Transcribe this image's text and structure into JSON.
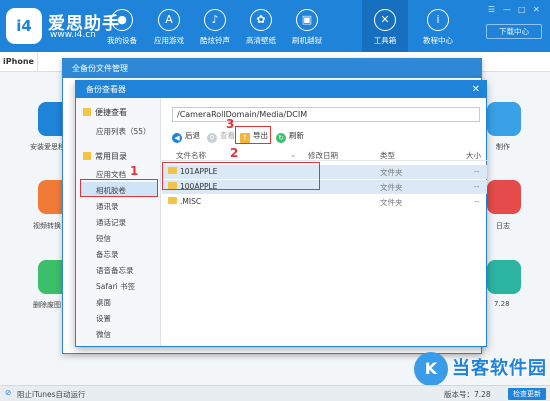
{
  "app": {
    "logo_text": "i4",
    "brand": "爱思助手",
    "url": "www.i4.cn",
    "download_center": "下载中心",
    "win_controls": [
      "☰",
      "—",
      "□",
      "✕"
    ]
  },
  "nav": [
    {
      "label": "我的设备",
      "icon": "apple-icon",
      "glyph": ""
    },
    {
      "label": "应用游戏",
      "icon": "appstore-icon",
      "glyph": "A"
    },
    {
      "label": "酷炫铃声",
      "icon": "bell-icon",
      "glyph": "♪"
    },
    {
      "label": "高清壁纸",
      "icon": "flower-icon",
      "glyph": "✿"
    },
    {
      "label": "刷机越狱",
      "icon": "box-icon",
      "glyph": "▣"
    },
    {
      "label": "工具箱",
      "icon": "tools-icon",
      "glyph": "✕"
    },
    {
      "label": "教程中心",
      "icon": "info-icon",
      "glyph": "i"
    }
  ],
  "device_tab": "iPhone",
  "background_labels": [
    "安装爱思移",
    "视频转换",
    "删除废图",
    "制作",
    "日志",
    "7.28"
  ],
  "dialog_outer": {
    "title": "全备份文件管理"
  },
  "dialog": {
    "title": "备份查看器",
    "close": "✕",
    "sidebar": {
      "group1": "便捷查看",
      "group1_items": [
        "应用列表（55）"
      ],
      "group2": "常用目录",
      "group2_items": [
        "应用文档",
        "相机胶卷",
        "通讯录",
        "通话记录",
        "短信",
        "备忘录",
        "语音备忘录",
        "Safari 书签",
        "桌面",
        "设置",
        "微信"
      ]
    },
    "path": "/CameraRollDomain/Media/DCIM",
    "toolbar": {
      "back": "后退",
      "find": "查看",
      "export": "导出",
      "refresh": "刷新"
    },
    "columns": {
      "name": "文件名称",
      "date": "修改日期",
      "type": "类型",
      "size": "大小"
    },
    "rows": [
      {
        "name": "101APPLE",
        "type": "文件夹",
        "size": "--"
      },
      {
        "name": "100APPLE",
        "type": "文件夹",
        "size": "--"
      },
      {
        "name": ".MISC",
        "type": "文件夹",
        "size": "--"
      }
    ]
  },
  "annotations": [
    "1",
    "2",
    "3"
  ],
  "status": {
    "itunes": "阻止iTunes自动运行",
    "version": "版本号：7.28",
    "update": "检查更新"
  },
  "watermark": {
    "text": "当客软件园"
  }
}
